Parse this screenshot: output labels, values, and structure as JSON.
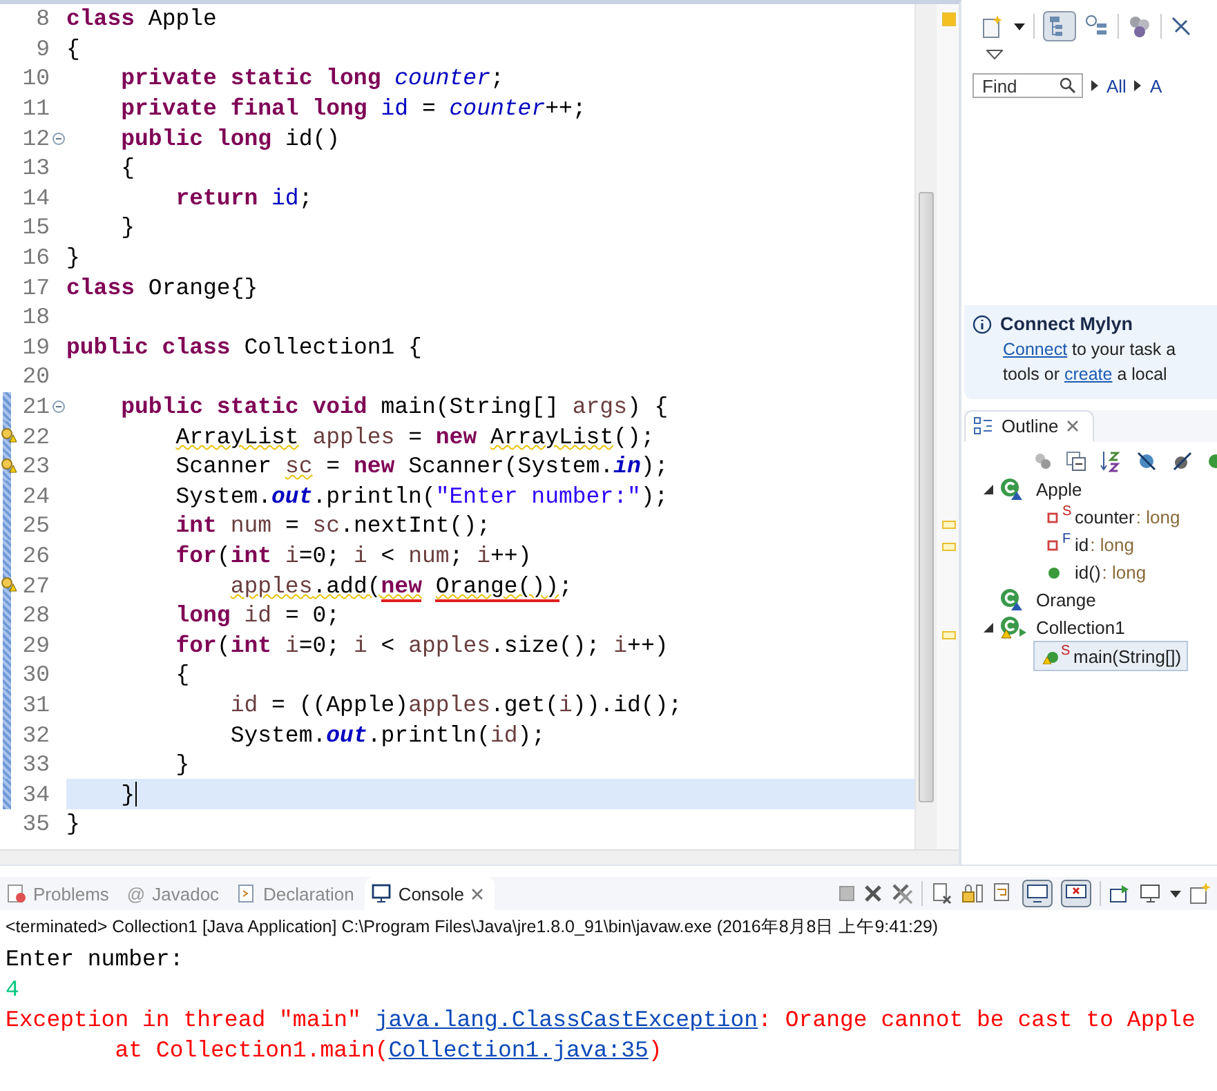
{
  "editor": {
    "lines": [
      {
        "number": "8",
        "fold": false,
        "warning": false,
        "range": false,
        "current": false,
        "tokens": [
          {
            "kind": "kw",
            "text": "class"
          },
          {
            "kind": "text",
            "text": " Apple"
          }
        ]
      },
      {
        "number": "9",
        "fold": false,
        "warning": false,
        "range": false,
        "current": false,
        "tokens": [
          {
            "kind": "text",
            "text": "{"
          }
        ]
      },
      {
        "number": "10",
        "fold": false,
        "warning": false,
        "range": false,
        "current": false,
        "tokens": [
          {
            "kind": "kw",
            "text": "    private static long "
          },
          {
            "kind": "static_field",
            "text": "counter"
          },
          {
            "kind": "text",
            "text": ";"
          }
        ]
      },
      {
        "number": "11",
        "fold": false,
        "warning": false,
        "range": false,
        "current": false,
        "tokens": [
          {
            "kind": "kw",
            "text": "    private final long "
          },
          {
            "kind": "field",
            "text": "id"
          },
          {
            "kind": "text",
            "text": " = "
          },
          {
            "kind": "static_field",
            "text": "counter"
          },
          {
            "kind": "text",
            "text": "++;"
          }
        ]
      },
      {
        "number": "12",
        "fold": true,
        "warning": false,
        "range": false,
        "current": false,
        "tokens": [
          {
            "kind": "kw",
            "text": "    public long "
          },
          {
            "kind": "text",
            "text": "id()"
          }
        ]
      },
      {
        "number": "13",
        "fold": false,
        "warning": false,
        "range": false,
        "current": false,
        "tokens": [
          {
            "kind": "text",
            "text": "    {"
          }
        ]
      },
      {
        "number": "14",
        "fold": false,
        "warning": false,
        "range": false,
        "current": false,
        "tokens": [
          {
            "kind": "kw",
            "text": "        return "
          },
          {
            "kind": "field",
            "text": "id"
          },
          {
            "kind": "text",
            "text": ";"
          }
        ]
      },
      {
        "number": "15",
        "fold": false,
        "warning": false,
        "range": false,
        "current": false,
        "tokens": [
          {
            "kind": "text",
            "text": "    }"
          }
        ]
      },
      {
        "number": "16",
        "fold": false,
        "warning": false,
        "range": false,
        "current": false,
        "tokens": [
          {
            "kind": "text",
            "text": "}"
          }
        ]
      },
      {
        "number": "17",
        "fold": false,
        "warning": false,
        "range": false,
        "current": false,
        "tokens": [
          {
            "kind": "kw",
            "text": "class "
          },
          {
            "kind": "text",
            "text": "Orange{}"
          }
        ]
      },
      {
        "number": "18",
        "fold": false,
        "warning": false,
        "range": false,
        "current": false
      },
      {
        "number": "19",
        "fold": false,
        "warning": false,
        "range": false,
        "current": false,
        "tokens": [
          {
            "kind": "kw",
            "text": "public class "
          },
          {
            "kind": "text",
            "text": "Collection1 {"
          }
        ]
      },
      {
        "number": "20",
        "fold": false,
        "warning": false,
        "range": false,
        "current": false
      },
      {
        "number": "21",
        "fold": true,
        "warning": false,
        "range": true,
        "current": false,
        "tokens": [
          {
            "kind": "kw",
            "text": "    public static void "
          },
          {
            "kind": "text",
            "text": "main(String[] "
          },
          {
            "kind": "local",
            "text": "args"
          },
          {
            "kind": "text",
            "text": ") {"
          }
        ]
      },
      {
        "number": "22",
        "fold": false,
        "warning": true,
        "range": true,
        "current": false,
        "tokens": [
          {
            "kind": "text",
            "text": "        ArrayList",
            "warning_underline": true
          },
          {
            "kind": "local",
            "text": " apples"
          },
          {
            "kind": "text",
            "text": " = "
          },
          {
            "kind": "kw",
            "text": "new "
          },
          {
            "kind": "text",
            "text": "ArrayList",
            "warning_underline": true
          },
          {
            "kind": "text",
            "text": "();"
          }
        ]
      },
      {
        "number": "23",
        "fold": false,
        "warning": true,
        "range": true,
        "current": false,
        "tokens": [
          {
            "kind": "text",
            "text": "        Scanner "
          },
          {
            "kind": "local",
            "text": "sc",
            "warning_underline": true
          },
          {
            "kind": "text",
            "text": " = "
          },
          {
            "kind": "kw",
            "text": "new "
          },
          {
            "kind": "text",
            "text": "Scanner(System."
          },
          {
            "kind": "constant",
            "text": "in"
          },
          {
            "kind": "text",
            "text": ");"
          }
        ]
      },
      {
        "number": "24",
        "fold": false,
        "warning": false,
        "range": true,
        "current": false,
        "tokens": [
          {
            "kind": "text",
            "text": "        System."
          },
          {
            "kind": "constant",
            "text": "out"
          },
          {
            "kind": "text",
            "text": ".println("
          },
          {
            "kind": "string",
            "text": "\"Enter number:\""
          },
          {
            "kind": "text",
            "text": ");"
          }
        ]
      },
      {
        "number": "25",
        "fold": false,
        "warning": false,
        "range": true,
        "current": false,
        "tokens": [
          {
            "kind": "kw",
            "text": "        int "
          },
          {
            "kind": "local",
            "text": "num"
          },
          {
            "kind": "text",
            "text": " = "
          },
          {
            "kind": "local",
            "text": "sc"
          },
          {
            "kind": "text",
            "text": ".nextInt();"
          }
        ]
      },
      {
        "number": "26",
        "fold": false,
        "warning": false,
        "range": true,
        "current": false,
        "tokens": [
          {
            "kind": "kw",
            "text": "        for"
          },
          {
            "kind": "text",
            "text": "("
          },
          {
            "kind": "kw",
            "text": "int "
          },
          {
            "kind": "local",
            "text": "i"
          },
          {
            "kind": "text",
            "text": "=0; "
          },
          {
            "kind": "local",
            "text": "i"
          },
          {
            "kind": "text",
            "text": " < "
          },
          {
            "kind": "local",
            "text": "num"
          },
          {
            "kind": "text",
            "text": "; "
          },
          {
            "kind": "local",
            "text": "i"
          },
          {
            "kind": "text",
            "text": "++)"
          }
        ]
      },
      {
        "number": "27",
        "fold": false,
        "warning": true,
        "range": true,
        "current": false,
        "tokens": [
          {
            "kind": "local",
            "text": "            apples",
            "warning_underline": true
          },
          {
            "kind": "text",
            "text": ".add(",
            "warning_underline": true
          },
          {
            "kind": "kw",
            "text": "new",
            "warning_underline": true,
            "error_underline": true
          },
          {
            "kind": "text",
            "text": " Orange())",
            "warning_underline": true,
            "error_underline": true
          },
          {
            "kind": "text",
            "text": ";"
          }
        ]
      },
      {
        "number": "28",
        "fold": false,
        "warning": false,
        "range": true,
        "current": false,
        "tokens": [
          {
            "kind": "kw",
            "text": "        long "
          },
          {
            "kind": "local",
            "text": "id"
          },
          {
            "kind": "text",
            "text": " = 0;"
          }
        ]
      },
      {
        "number": "29",
        "fold": false,
        "warning": false,
        "range": true,
        "current": false,
        "tokens": [
          {
            "kind": "kw",
            "text": "        for"
          },
          {
            "kind": "text",
            "text": "("
          },
          {
            "kind": "kw",
            "text": "int "
          },
          {
            "kind": "local",
            "text": "i"
          },
          {
            "kind": "text",
            "text": "=0; "
          },
          {
            "kind": "local",
            "text": "i"
          },
          {
            "kind": "text",
            "text": " < "
          },
          {
            "kind": "local",
            "text": "apples"
          },
          {
            "kind": "text",
            "text": ".size(); "
          },
          {
            "kind": "local",
            "text": "i"
          },
          {
            "kind": "text",
            "text": "++)"
          }
        ]
      },
      {
        "number": "30",
        "fold": false,
        "warning": false,
        "range": true,
        "current": false,
        "tokens": [
          {
            "kind": "text",
            "text": "        {"
          }
        ]
      },
      {
        "number": "31",
        "fold": false,
        "warning": false,
        "range": true,
        "current": false,
        "tokens": [
          {
            "kind": "local",
            "text": "            id"
          },
          {
            "kind": "text",
            "text": " = ((Apple)"
          },
          {
            "kind": "local",
            "text": "apples"
          },
          {
            "kind": "text",
            "text": ".get("
          },
          {
            "kind": "local",
            "text": "i"
          },
          {
            "kind": "text",
            "text": ")).id();"
          }
        ]
      },
      {
        "number": "32",
        "fold": false,
        "warning": false,
        "range": true,
        "current": false,
        "tokens": [
          {
            "kind": "text",
            "text": "            System."
          },
          {
            "kind": "constant",
            "text": "out"
          },
          {
            "kind": "text",
            "text": ".println("
          },
          {
            "kind": "local",
            "text": "id"
          },
          {
            "kind": "text",
            "text": ");"
          }
        ]
      },
      {
        "number": "33",
        "fold": false,
        "warning": false,
        "range": true,
        "current": false,
        "tokens": [
          {
            "kind": "text",
            "text": "        }"
          }
        ]
      },
      {
        "number": "34",
        "fold": false,
        "warning": false,
        "range": true,
        "current": true,
        "tokens": [
          {
            "kind": "text",
            "text": "    }"
          }
        ]
      },
      {
        "number": "35",
        "fold": false,
        "warning": false,
        "range": false,
        "current": false,
        "tokens": [
          {
            "kind": "text",
            "text": "}"
          }
        ]
      }
    ]
  },
  "task_panel": {
    "find": {
      "placeholder": "Find"
    },
    "filters": [
      {
        "label": "All"
      },
      {
        "label": "A"
      }
    ],
    "mylyn": {
      "title": "Connect Mylyn",
      "line_1": [
        {
          "text": "Connect",
          "link": true
        },
        {
          "text": " to your task a",
          "link": false
        }
      ],
      "line_2": [
        {
          "text": "tools or ",
          "link": false
        },
        {
          "text": "create",
          "link": true
        },
        {
          "text": " a local",
          "link": false
        }
      ]
    }
  },
  "outline": {
    "tab": {
      "label": "Outline",
      "selected": true
    },
    "items": [
      {
        "kind": "class",
        "name": "Apple",
        "expanded": true,
        "warning": false,
        "children": [
          {
            "kind": "private_field",
            "modifier": "S",
            "name": "counter",
            "type": " : long",
            "warning": false,
            "selected": false
          },
          {
            "kind": "private_field",
            "modifier": "F",
            "name": "id",
            "type": " : long",
            "warning": false,
            "selected": false
          },
          {
            "kind": "public_method",
            "name": "id()",
            "type": " : long",
            "warning": false,
            "selected": false
          }
        ]
      },
      {
        "kind": "class",
        "name": "Orange",
        "warning": false
      },
      {
        "kind": "main_class",
        "name": "Collection1",
        "expanded": true,
        "warning": true,
        "children": [
          {
            "kind": "public_method",
            "modifier": "S",
            "name": "main(String[])",
            "warning": true,
            "selected": true
          }
        ]
      }
    ]
  },
  "console": {
    "tabs": [
      {
        "kind": "problems",
        "label": "Problems",
        "selected": false
      },
      {
        "kind": "javadoc",
        "glyph": "@",
        "label": "Javadoc",
        "selected": false
      },
      {
        "kind": "declaration",
        "label": "Declaration",
        "selected": false
      },
      {
        "kind": "console",
        "label": "Console",
        "selected": true
      }
    ],
    "process": "<terminated> Collection1 [Java Application] C:\\Program Files\\Java\\jre1.8.0_91\\bin\\javaw.exe (2016年8月8日 上午9:41:29)",
    "output": [
      {
        "kind": "stdout",
        "segments": [
          {
            "text": "Enter number:",
            "link": false
          }
        ]
      },
      {
        "kind": "stdin",
        "segments": [
          {
            "text": "4",
            "link": false
          }
        ]
      },
      {
        "kind": "stderr",
        "segments": [
          {
            "text": "Exception in thread \"main\" ",
            "link": false
          },
          {
            "text": "java.lang.ClassCastException",
            "link": true
          },
          {
            "text": ": Orange cannot be cast to Apple",
            "link": false
          }
        ]
      },
      {
        "kind": "stderr",
        "segments": [
          {
            "text": "        at Collection1.main(",
            "link": false
          },
          {
            "text": "Collection1.java:35",
            "link": true
          },
          {
            "text": ")",
            "link": false
          }
        ]
      }
    ]
  }
}
